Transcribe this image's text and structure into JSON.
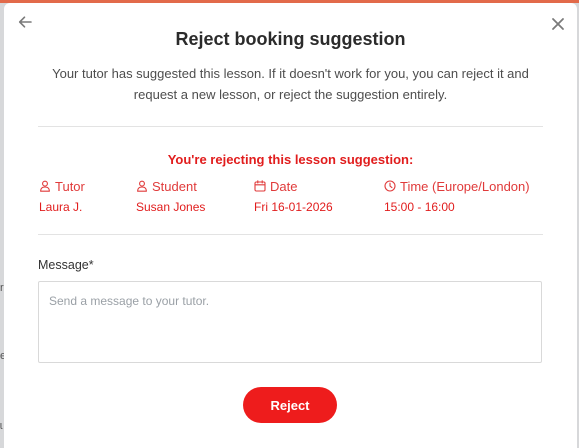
{
  "dialog": {
    "title": "Reject booking suggestion",
    "subtitle": "Your tutor has suggested this lesson. If it doesn't work for you, you can reject it and request a new lesson, or reject the suggestion entirely.",
    "warning": "You're rejecting this lesson suggestion:",
    "back_icon": "arrow-left-icon",
    "close_icon": "close-icon"
  },
  "details": {
    "tutor": {
      "label": "Tutor",
      "value": "Laura J.",
      "icon": "user-icon"
    },
    "student": {
      "label": "Student",
      "value": "Susan Jones",
      "icon": "user-icon"
    },
    "date": {
      "label": "Date",
      "value": "Fri 16-01-2026",
      "icon": "calendar-icon"
    },
    "time": {
      "label": "Time (Europe/London)",
      "value": "15:00 - 16:00",
      "icon": "clock-icon"
    }
  },
  "message": {
    "label": "Message*",
    "placeholder": "Send a message to your tutor.",
    "value": ""
  },
  "actions": {
    "reject_label": "Reject"
  },
  "colors": {
    "accent": "#ee1c1c",
    "text_red": "#e11d1d"
  }
}
